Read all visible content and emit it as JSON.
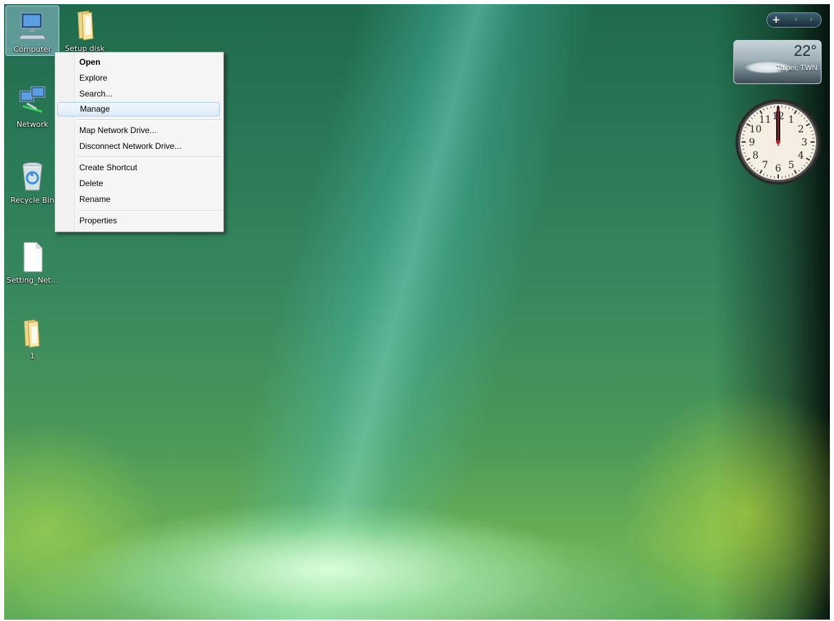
{
  "desktop": {
    "icons": [
      {
        "label": "Computer",
        "icon": "computer-icon"
      },
      {
        "label": "Setup disk",
        "icon": "folder-icon"
      },
      {
        "label": "Network",
        "icon": "network-icon"
      },
      {
        "label": "Recycle Bin",
        "icon": "recycle-bin-icon"
      },
      {
        "label": "Setting_Net...",
        "icon": "document-icon"
      },
      {
        "label": "1",
        "icon": "folder-icon"
      }
    ]
  },
  "context_menu": {
    "items": [
      {
        "label": "Open",
        "bold": true
      },
      {
        "label": "Explore"
      },
      {
        "label": "Search..."
      },
      {
        "label": "Manage",
        "hovered": true
      },
      {
        "label": "Map Network Drive..."
      },
      {
        "label": "Disconnect Network Drive..."
      },
      {
        "label": "Create Shortcut"
      },
      {
        "label": "Delete"
      },
      {
        "label": "Rename"
      },
      {
        "label": "Properties"
      }
    ]
  },
  "gadgets": {
    "toolbar": {
      "add": "+",
      "prev": "‹",
      "next": "›"
    },
    "weather": {
      "temperature": "22°",
      "city": "Taipei, TWN"
    },
    "clock": {
      "numerals": [
        "12",
        "1",
        "2",
        "3",
        "4",
        "5",
        "6",
        "7",
        "8",
        "9",
        "10",
        "11"
      ],
      "time": "12:00"
    }
  },
  "colors": {
    "menu_hover": "#dceaf7",
    "menu_border": "#979797",
    "desktop_green": "#2b7a58"
  }
}
